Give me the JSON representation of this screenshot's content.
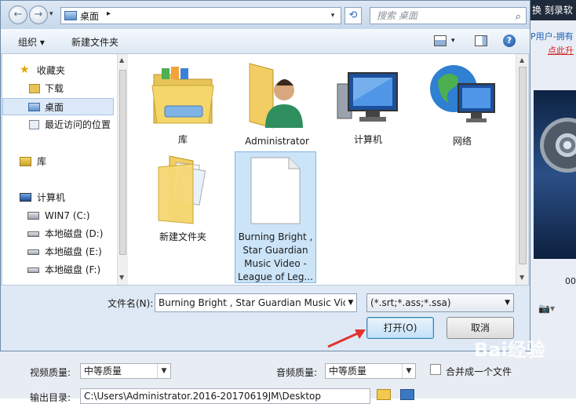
{
  "background_app": {
    "top_right_text": "换  刻录软",
    "promo_text": "P用户-拥有",
    "promo_link": "点此升",
    "preview_counter": "00",
    "video_quality_label": "视频质量:",
    "video_quality_value": "中等质量",
    "audio_quality_label": "音频质量:",
    "audio_quality_value": "中等质量",
    "merge_label": "合并成一个文件",
    "output_dir_label": "输出目录:",
    "output_dir_value": "C:\\Users\\Administrator.2016-20170619JM\\Desktop"
  },
  "dialog": {
    "address": {
      "path": "桌面",
      "breadcrumb_arrow": "▸",
      "dropdown": "▾"
    },
    "search_placeholder": "搜索 桌面",
    "toolbar": {
      "organize_label": "组织 ▾",
      "new_folder_label": "新建文件夹"
    },
    "nav_pane": {
      "favorites": "收藏夹",
      "downloads": "下载",
      "desktop": "桌面",
      "recent": "最近访问的位置",
      "libraries": "库",
      "computer": "计算机",
      "drive_c": "WIN7 (C:)",
      "drive_d": "本地磁盘 (D:)",
      "drive_e": "本地磁盘 (E:)",
      "drive_f": "本地磁盘 (F:)"
    },
    "files": [
      {
        "name_lines": [
          "库"
        ]
      },
      {
        "name_lines": [
          "Administrator"
        ]
      },
      {
        "name_lines": [
          "计算机"
        ]
      },
      {
        "name_lines": [
          "网络"
        ]
      },
      {
        "name_lines": [
          "新建文件夹"
        ]
      },
      {
        "name_lines": [
          "Burning Bright ,",
          "Star Guardian",
          "Music Video -",
          "League of Leg..."
        ]
      }
    ],
    "file_name_label": "文件名(N):",
    "file_name_value": "Burning Bright , Star Guardian Music Vid",
    "file_type_value": "(*.srt;*.ass;*.ssa)",
    "open_button": "打开(O)",
    "cancel_button": "取消"
  },
  "watermark": "Bai经验"
}
